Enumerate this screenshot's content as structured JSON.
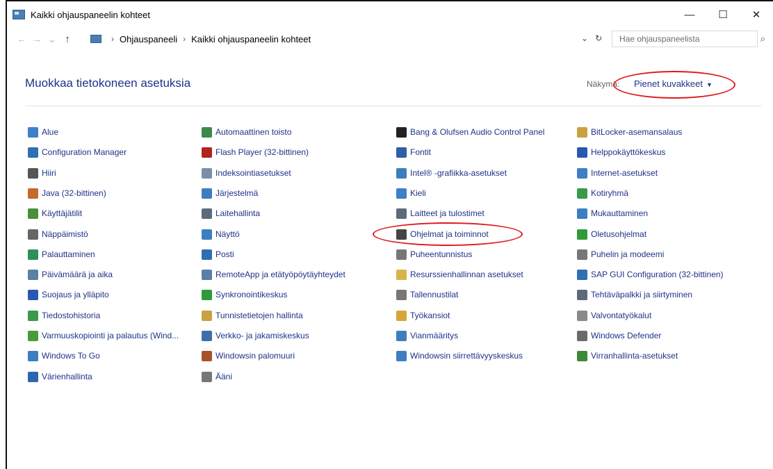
{
  "window": {
    "title": "Kaikki ohjauspaneelin kohteet",
    "controls": [
      "—",
      "☐",
      "✕"
    ]
  },
  "address": {
    "back": "←",
    "forward": "→",
    "recent": "⌄",
    "up": "↑",
    "crumbs": [
      "Ohjauspaneeli",
      "Kaikki ohjauspaneelin kohteet"
    ],
    "sep": "›",
    "dropdown": "⌄",
    "refresh": "↻",
    "search_placeholder": "Hae ohjauspaneelista",
    "search_icon": "⌕"
  },
  "header": {
    "title": "Muokkaa tietokoneen asetuksia",
    "view_by_label": "Näkymä:",
    "view_by_value": "Pienet kuvakkeet",
    "caret": "▼"
  },
  "columns": [
    [
      {
        "label": "Alue",
        "icon": "globe-icon",
        "color": "#3f7fc7"
      },
      {
        "label": "Configuration Manager",
        "icon": "config-manager-icon",
        "color": "#2f6fb3"
      },
      {
        "label": "Hiiri",
        "icon": "mouse-icon",
        "color": "#555555"
      },
      {
        "label": "Java (32-bittinen)",
        "icon": "java-icon",
        "color": "#c46a2b"
      },
      {
        "label": "Käyttäjätilit",
        "icon": "users-icon",
        "color": "#4a8f3a"
      },
      {
        "label": "Näppäimistö",
        "icon": "keyboard-icon",
        "color": "#666666"
      },
      {
        "label": "Palauttaminen",
        "icon": "recovery-icon",
        "color": "#2d8f5c"
      },
      {
        "label": "Päivämäärä ja aika",
        "icon": "clock-icon",
        "color": "#5b7fa5"
      },
      {
        "label": "Suojaus ja ylläpito",
        "icon": "flag-icon",
        "color": "#2a58b0"
      },
      {
        "label": "Tiedostohistoria",
        "icon": "file-history-icon",
        "color": "#3a9a4a"
      },
      {
        "label": "Varmuuskopiointi ja palautus (Wind...",
        "icon": "backup-icon",
        "color": "#4a9a3a"
      },
      {
        "label": "Windows To Go",
        "icon": "windows-to-go-icon",
        "color": "#3d7ec0"
      },
      {
        "label": "Värienhallinta",
        "icon": "color-management-icon",
        "color": "#2c66b0"
      }
    ],
    [
      {
        "label": "Automaattinen toisto",
        "icon": "autoplay-icon",
        "color": "#3c8a4a"
      },
      {
        "label": "Flash Player (32-bittinen)",
        "icon": "flash-icon",
        "color": "#b2221c"
      },
      {
        "label": "Indeksointiasetukset",
        "icon": "indexing-icon",
        "color": "#7a8ea8"
      },
      {
        "label": "Järjestelmä",
        "icon": "system-icon",
        "color": "#3d7ec0"
      },
      {
        "label": "Laitehallinta",
        "icon": "device-manager-icon",
        "color": "#5c6a7a"
      },
      {
        "label": "Näyttö",
        "icon": "display-icon",
        "color": "#3d7ec0"
      },
      {
        "label": "Posti",
        "icon": "mail-icon",
        "color": "#2d6fb0"
      },
      {
        "label": "RemoteApp ja etätyöpöytäyhteydet",
        "icon": "remoteapp-icon",
        "color": "#5a7fa5"
      },
      {
        "label": "Synkronointikeskus",
        "icon": "sync-icon",
        "color": "#2f9a3a"
      },
      {
        "label": "Tunnistetietojen hallinta",
        "icon": "credential-icon",
        "color": "#c9a042"
      },
      {
        "label": "Verkko- ja jakamiskeskus",
        "icon": "network-icon",
        "color": "#3f6fa8"
      },
      {
        "label": "Windowsin palomuuri",
        "icon": "firewall-icon",
        "color": "#a8522a"
      },
      {
        "label": "Ääni",
        "icon": "speaker-icon",
        "color": "#777777"
      }
    ],
    [
      {
        "label": "Bang & Olufsen Audio Control Panel",
        "icon": "bang-olufsen-icon",
        "color": "#222222"
      },
      {
        "label": "Fontit",
        "icon": "fonts-icon",
        "color": "#2c5fa8"
      },
      {
        "label": "Intel® -grafiikka-asetukset",
        "icon": "intel-graphics-icon",
        "color": "#3d7ec0"
      },
      {
        "label": "Kieli",
        "icon": "language-icon",
        "color": "#3f7fc7"
      },
      {
        "label": "Laitteet ja tulostimet",
        "icon": "printer-icon",
        "color": "#5c6a7a"
      },
      {
        "label": "Ohjelmat ja toiminnot",
        "icon": "programs-icon",
        "color": "#444444"
      },
      {
        "label": "Puheentunnistus",
        "icon": "microphone-icon",
        "color": "#777777"
      },
      {
        "label": "Resurssienhallinnan asetukset",
        "icon": "explorer-options-icon",
        "color": "#d8b44a"
      },
      {
        "label": "Tallennustilat",
        "icon": "storage-icon",
        "color": "#777777"
      },
      {
        "label": "Työkansiot",
        "icon": "work-folders-icon",
        "color": "#d8a53a"
      },
      {
        "label": "Vianmääritys",
        "icon": "troubleshoot-icon",
        "color": "#3d7ec0"
      },
      {
        "label": "Windowsin siirrettävyyskeskus",
        "icon": "mobility-center-icon",
        "color": "#3d7ec0"
      }
    ],
    [
      {
        "label": "BitLocker-asemansalaus",
        "icon": "bitlocker-icon",
        "color": "#c9a042"
      },
      {
        "label": "Helppokäyttökeskus",
        "icon": "ease-of-access-icon",
        "color": "#2a58b0"
      },
      {
        "label": "Internet-asetukset",
        "icon": "internet-options-icon",
        "color": "#3f7fc7"
      },
      {
        "label": "Kotiryhmä",
        "icon": "homegroup-icon",
        "color": "#3a9a4a"
      },
      {
        "label": "Mukauttaminen",
        "icon": "personalization-icon",
        "color": "#3d7ec0"
      },
      {
        "label": "Oletusohjelmat",
        "icon": "default-programs-icon",
        "color": "#2f9a3a"
      },
      {
        "label": "Puhelin ja modeemi",
        "icon": "phone-modem-icon",
        "color": "#777777"
      },
      {
        "label": "SAP GUI Configuration (32-bittinen)",
        "icon": "sap-icon",
        "color": "#2f6fb3"
      },
      {
        "label": "Tehtäväpalkki ja siirtyminen",
        "icon": "taskbar-icon",
        "color": "#5c6a7a"
      },
      {
        "label": "Valvontatyökalut",
        "icon": "admin-tools-icon",
        "color": "#8a8a8a"
      },
      {
        "label": "Windows Defender",
        "icon": "defender-icon",
        "color": "#6a6a6a"
      },
      {
        "label": "Virranhallinta-asetukset",
        "icon": "power-options-icon",
        "color": "#3a8a3a"
      }
    ]
  ],
  "highlight_color": "#e0181b"
}
